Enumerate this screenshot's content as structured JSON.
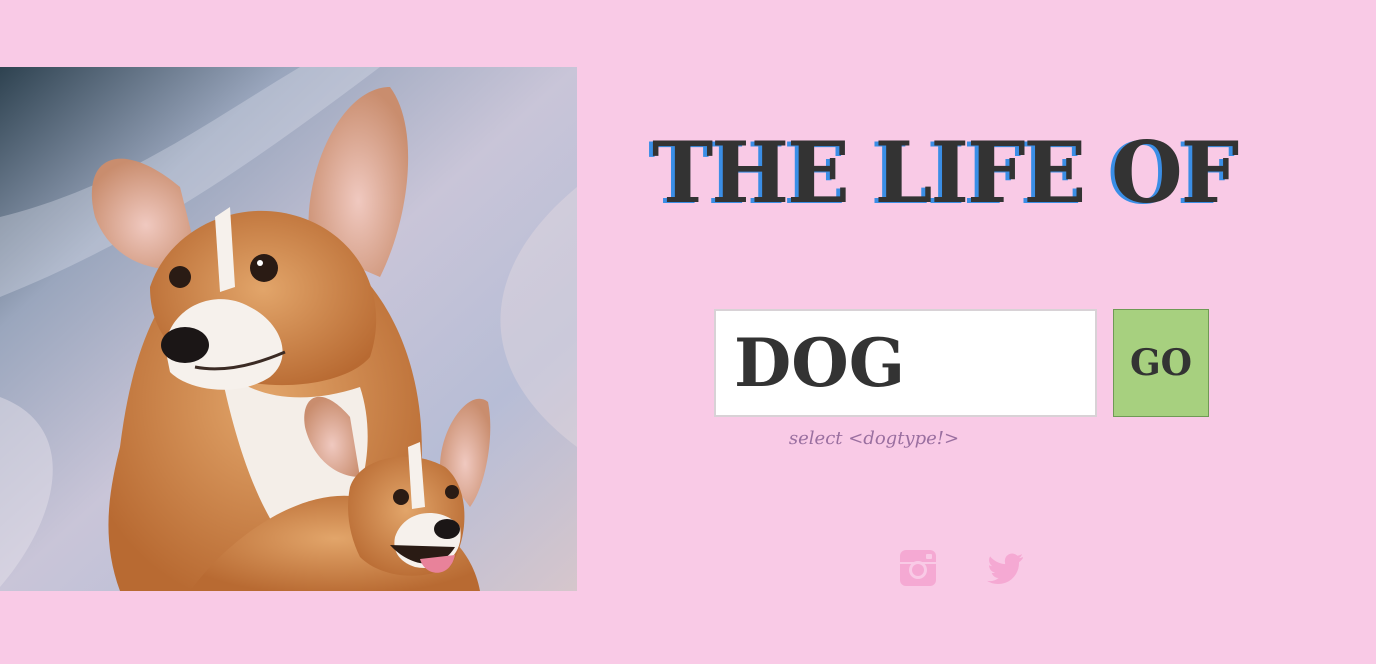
{
  "page": {
    "title": "THE LIFE OF",
    "background_color": "#f9cae6"
  },
  "hero": {
    "icon": "corgi-painting-image"
  },
  "search": {
    "value": "DOG",
    "go_label": "GO",
    "hint": "select <dogtype!>"
  },
  "social": {
    "items": [
      {
        "icon": "instagram-icon"
      },
      {
        "icon": "twitter-icon"
      }
    ],
    "icon_color": "#f5a9d3"
  },
  "colors": {
    "title": "#333333",
    "title_shadow": "#3a8ee6",
    "go_button": "#a7d07f",
    "hint": "#9a6fa0"
  }
}
